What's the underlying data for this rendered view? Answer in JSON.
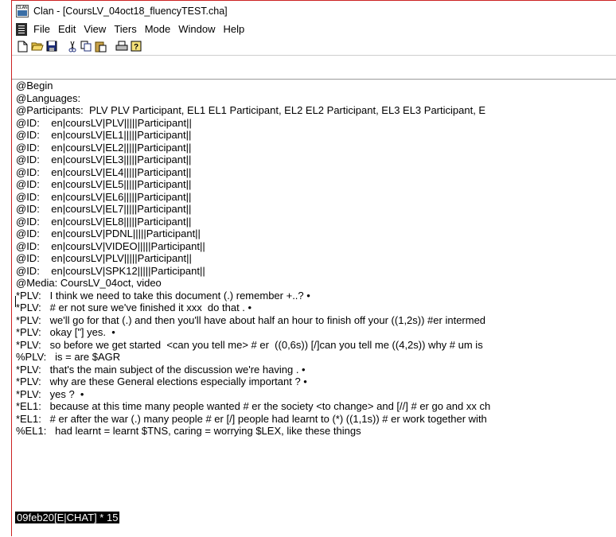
{
  "window": {
    "title": "Clan - [CoursLV_04oct18_fluencyTEST.cha]",
    "app_icon_label": "CLAN"
  },
  "menu": {
    "items": [
      "File",
      "Edit",
      "View",
      "Tiers",
      "Mode",
      "Window",
      "Help"
    ]
  },
  "toolbar": {
    "buttons": [
      "new-icon",
      "open-icon",
      "save-icon",
      "cut-icon",
      "copy-icon",
      "paste-icon",
      "print-icon",
      "help-icon"
    ]
  },
  "editor": {
    "lines": [
      "@Begin",
      "@Languages:",
      "@Participants:  PLV PLV Participant, EL1 EL1 Participant, EL2 EL2 Participant, EL3 EL3 Participant, E",
      "@ID:    en|coursLV|PLV|||||Participant||",
      "@ID:    en|coursLV|EL1|||||Participant||",
      "@ID:    en|coursLV|EL2|||||Participant||",
      "@ID:    en|coursLV|EL3|||||Participant||",
      "@ID:    en|coursLV|EL4|||||Participant||",
      "@ID:    en|coursLV|EL5|||||Participant||",
      "@ID:    en|coursLV|EL6|||||Participant||",
      "@ID:    en|coursLV|EL7|||||Participant||",
      "@ID:    en|coursLV|EL8|||||Participant||",
      "@ID:    en|coursLV|PDNL|||||Participant||",
      "@ID:    en|coursLV|VIDEO|||||Participant||",
      "@ID:    en|coursLV|PLV|||||Participant||",
      "@ID:    en|coursLV|SPK12|||||Participant||",
      "@Media: CoursLV_04oct, video",
      "*PLV:   I think we need to take this document (.) remember +..? •",
      "*PLV:   # er not sure we've finished it xxx  do that . •",
      "*PLV:   we'll go for that (.) and then you'll have about half an hour to finish off your ((1,2s)) #er intermed",
      "*PLV:   okay [\"] yes.  •",
      "*PLV:   so before we get started  <can you tell me> # er  ((0,6s)) [/]can you tell me ((4,2s)) why # um is",
      "%PLV:   is = are $AGR",
      "*PLV:   that's the main subject of the discussion we're having . •",
      "*PLV:   why are these General elections especially important ? •",
      "*PLV:   yes ?  •",
      "*EL1:   because at this time many people wanted # er the society <to change> and [//] # er go and xx ch",
      "*EL1:   # er after the war (.) many people # er [/] people had learnt to (*) ((1,1s)) # er work together with",
      "%EL1:   had learnt = learnt $TNS, caring = worrying $LEX, like these things"
    ],
    "status_text": "09feb20[E|CHAT] * 15"
  }
}
